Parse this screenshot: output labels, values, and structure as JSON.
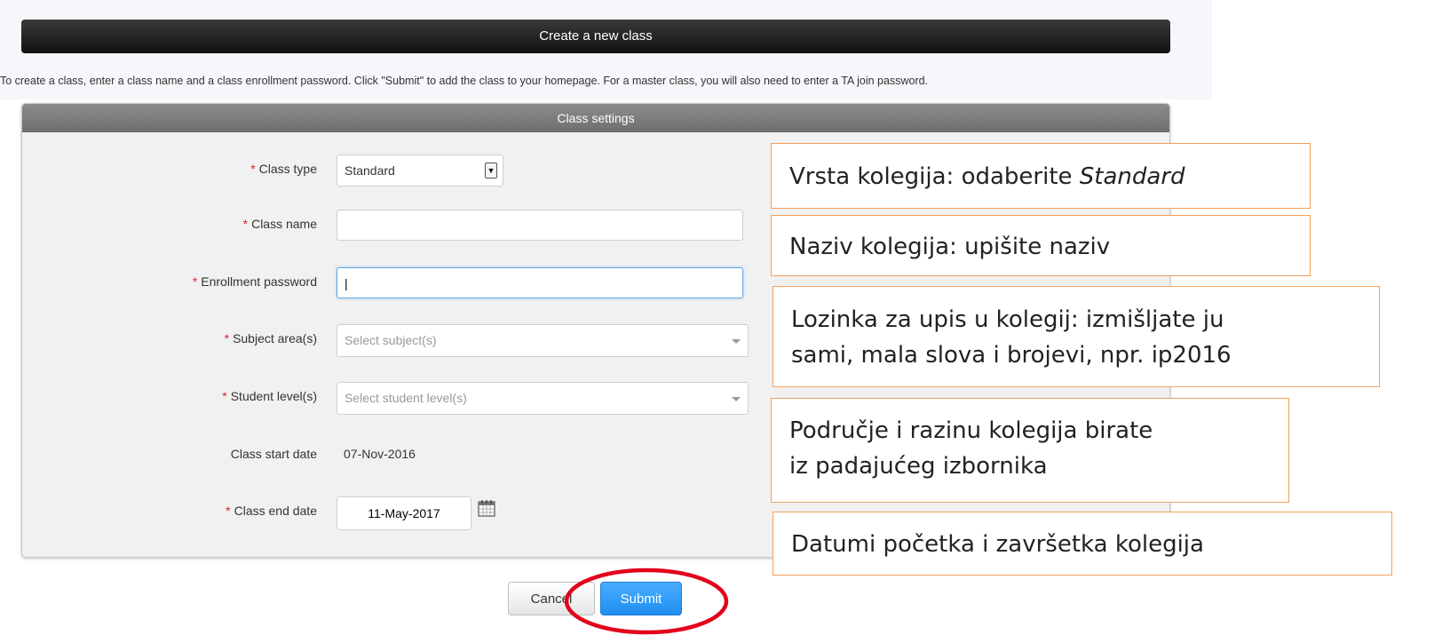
{
  "header": {
    "title": "Create a new class"
  },
  "instructions": "To create a class, enter a class name and a class enrollment password. Click \"Submit\" to add the class to your homepage. For a master class, you will also need to enter a TA join password.",
  "panel": {
    "title": "Class settings",
    "fields": {
      "class_type": {
        "label": "Class type",
        "value": "Standard"
      },
      "class_name": {
        "label": "Class name",
        "value": ""
      },
      "enrollment_password": {
        "label": "Enrollment password",
        "value": "|"
      },
      "subject_area": {
        "label": "Subject area(s)",
        "placeholder": "Select subject(s)"
      },
      "student_level": {
        "label": "Student level(s)",
        "placeholder": "Select student level(s)"
      },
      "start_date": {
        "label": "Class start date",
        "value": "07-Nov-2016"
      },
      "end_date": {
        "label": "Class end date",
        "value": "11-May-2017"
      }
    },
    "required_mark": "*"
  },
  "buttons": {
    "cancel": "Cancel",
    "submit": "Submit"
  },
  "callouts": {
    "class_type_prefix": "Vrsta kolegija: odaberite ",
    "class_type_em": "Standard",
    "class_name": "Naziv kolegija: upišite naziv",
    "password_line1": "Lozinka za upis u kolegij: izmišljate ju",
    "password_line2": "sami, mala slova i brojevi, npr. ip2016",
    "subject_line1": "Područje i razinu kolegija birate",
    "subject_line2": "iz padajućeg izbornika",
    "dates": "Datumi početka i završetka kolegija"
  },
  "colors": {
    "accent_blue": "#1f8ef1",
    "required_red": "#d9232d",
    "callout_border": "#f2a05a",
    "highlight_red": "#e3001b"
  }
}
